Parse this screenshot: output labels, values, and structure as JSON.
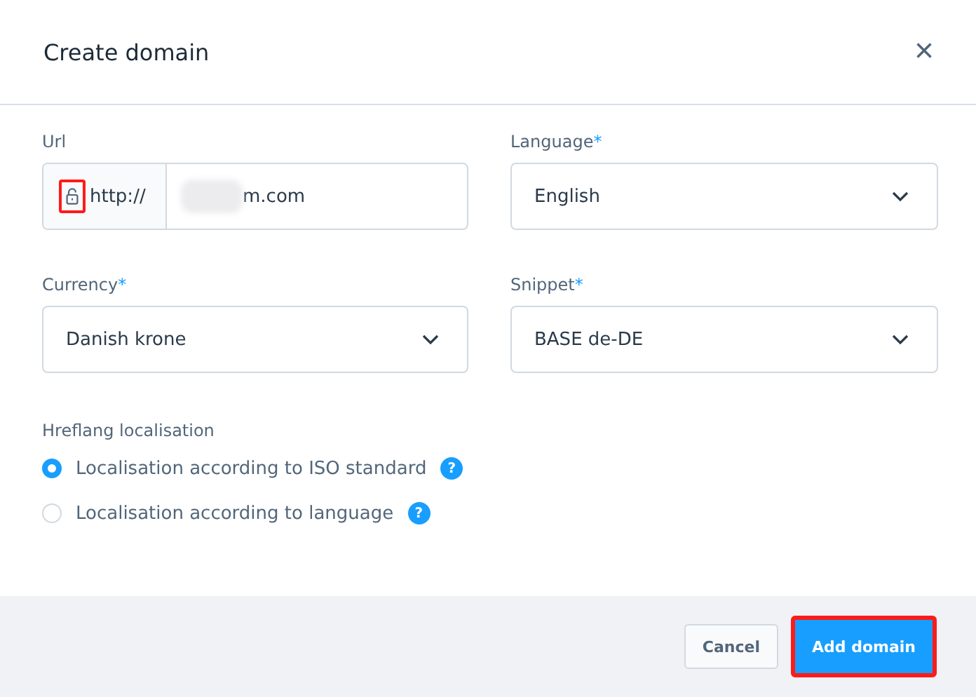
{
  "dialog": {
    "title": "Create domain",
    "close_icon": "×"
  },
  "url": {
    "label": "Url",
    "prefix": "http://",
    "value": "m.com",
    "highlighted_icon": true
  },
  "fields": [
    {
      "label": "Language",
      "required_mark": "*",
      "value": "English"
    },
    {
      "label": "Currency",
      "required_mark": "*",
      "value": "Danish krone"
    },
    {
      "label": "Snippet",
      "required_mark": "*",
      "value": "BASE de-DE"
    }
  ],
  "hreflang": {
    "label": "Hreflang localisation",
    "options": [
      {
        "label": "Localisation according to ISO standard",
        "selected": true,
        "help": "?"
      },
      {
        "label": "Localisation according to language",
        "selected": false,
        "help": "?"
      }
    ]
  },
  "buttons": [
    {
      "label": "Cancel",
      "kind": "secondary",
      "highlighted": false
    },
    {
      "label": "Add domain",
      "kind": "primary",
      "highlighted": true
    }
  ]
}
